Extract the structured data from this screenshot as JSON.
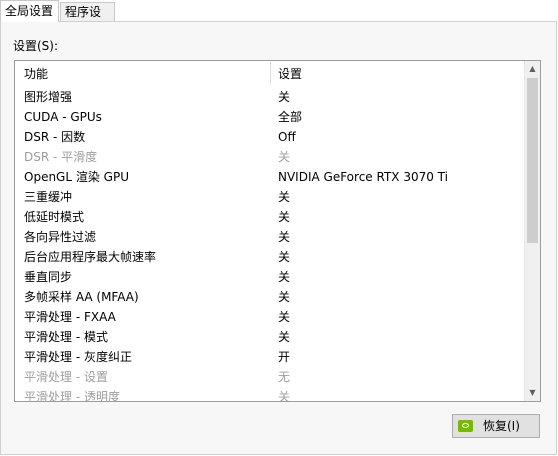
{
  "tabs": [
    {
      "label": "全局设置"
    },
    {
      "label": "程序设置"
    }
  ],
  "settings_label": "设置(S):",
  "table": {
    "columns": [
      "功能",
      "设置"
    ],
    "rows": [
      {
        "feature": "图形增强",
        "value": "关"
      },
      {
        "feature": "CUDA - GPUs",
        "value": "全部"
      },
      {
        "feature": "DSR - 因数",
        "value": "Off"
      },
      {
        "feature": "DSR - 平滑度",
        "value": "关"
      },
      {
        "feature": "OpenGL 渲染 GPU",
        "value": "NVIDIA GeForce RTX 3070 Ti"
      },
      {
        "feature": "三重缓冲",
        "value": "关"
      },
      {
        "feature": "低延时模式",
        "value": "关"
      },
      {
        "feature": "各向异性过滤",
        "value": "关"
      },
      {
        "feature": "后台应用程序最大帧速率",
        "value": "关"
      },
      {
        "feature": "垂直同步",
        "value": "关"
      },
      {
        "feature": "多帧采样 AA (MFAA)",
        "value": "关"
      },
      {
        "feature": "平滑处理 - FXAA",
        "value": "关"
      },
      {
        "feature": "平滑处理 - 模式",
        "value": "关"
      },
      {
        "feature": "平滑处理 - 灰度纠正",
        "value": "开"
      },
      {
        "feature": "平滑处理 - 设置",
        "value": "无"
      },
      {
        "feature": "平滑处理 - 透明度",
        "value": "关"
      }
    ]
  },
  "restore_button": {
    "label": "恢复(I)",
    "icon": "nvidia-logo-icon"
  }
}
